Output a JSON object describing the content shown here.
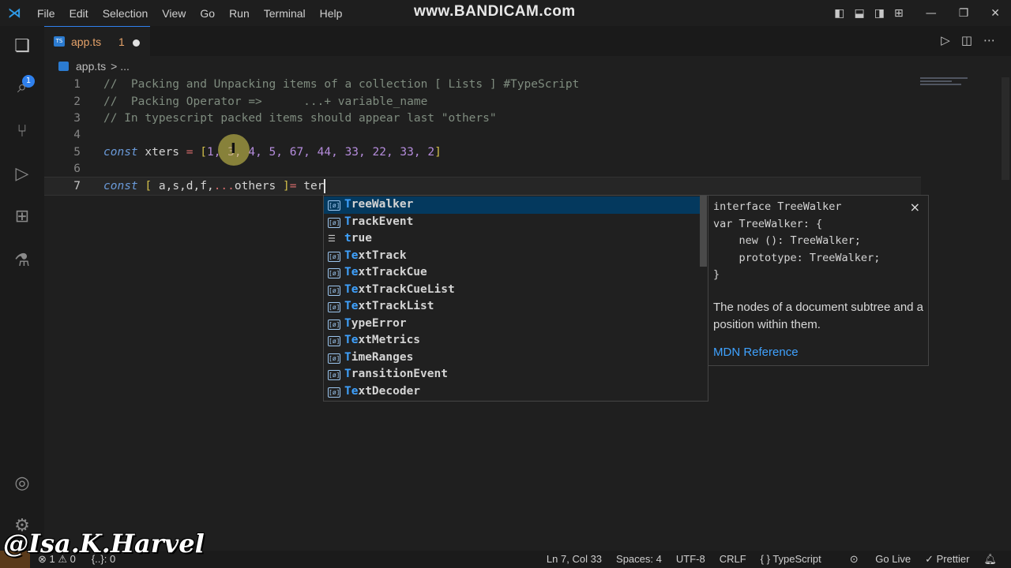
{
  "titlebar": {
    "menu": [
      "File",
      "Edit",
      "Selection",
      "View",
      "Go",
      "Run",
      "Terminal",
      "Help"
    ],
    "watermark": "www.BANDICAM.com"
  },
  "activity": {
    "badge": "1"
  },
  "tab": {
    "name": "app.ts",
    "count": "1",
    "ts_icon": "TS"
  },
  "breadcrumb": {
    "file": "app.ts",
    "rest": "> ..."
  },
  "editor": {
    "line_numbers": [
      "1",
      "2",
      "3",
      "4",
      "5",
      "6",
      "7"
    ],
    "line1": "//  Packing and Unpacking items of a collection [ Lists ] #TypeScript",
    "line2": "//  Packing Operator =>      ...+ variable_name",
    "line3": "// In typescript packed items should appear last \"others\"",
    "line5": {
      "kw": "const",
      "name": " xters ",
      "eq": "=",
      "open": " [",
      "nums": "1, 3, 4, 5, 67, 44, 33, 22, 33, 2",
      "close": "]"
    },
    "line7": {
      "kw": "const",
      "open": " [ ",
      "vars": "a,s,d,f,",
      "spread": "...",
      "rest": "others ",
      "close": "]",
      "eq": "=",
      "typed": " ter"
    }
  },
  "suggest": {
    "items": [
      {
        "match": "T",
        "text": "reeWalker",
        "kind": "ref"
      },
      {
        "match": "T",
        "text": "rackEvent",
        "kind": "ref"
      },
      {
        "match": "t",
        "text": "rue",
        "kind": "kw"
      },
      {
        "match": "Te",
        "text": "xtTrack",
        "kind": "ref"
      },
      {
        "match": "Te",
        "text": "xtTrackCue",
        "kind": "ref"
      },
      {
        "match": "Te",
        "text": "xtTrackCueList",
        "kind": "ref"
      },
      {
        "match": "Te",
        "text": "xtTrackList",
        "kind": "ref"
      },
      {
        "match": "T",
        "text": "ypeError",
        "kind": "ref"
      },
      {
        "match": "Te",
        "text": "xtMetrics",
        "kind": "ref"
      },
      {
        "match": "T",
        "text": "imeRanges",
        "kind": "ref"
      },
      {
        "match": "T",
        "text": "ransitionEvent",
        "kind": "ref"
      },
      {
        "match": "Te",
        "text": "xtDecoder",
        "kind": "ref"
      }
    ],
    "ref_icon": "[ø]"
  },
  "doc": {
    "signature": "interface TreeWalker\nvar TreeWalker: {\n    new (): TreeWalker;\n    prototype: TreeWalker;\n}",
    "description": "The nodes of a document subtree and a position within them.",
    "link": "MDN Reference",
    "close": "×"
  },
  "status": {
    "problems": "⊗ 1 ⚠ 0",
    "braces": "{..}: 0",
    "position": "Ln 7, Col 33",
    "spaces": "Spaces: 4",
    "encoding": "UTF-8",
    "eol": "CRLF",
    "language": "{ }  TypeScript",
    "golive": "Go Live",
    "prettier": "✓ Prettier"
  },
  "overlay": {
    "handle": "@Isa.K.Harvel"
  },
  "colors": {
    "accent": "#2f80ed",
    "selection": "#04395e",
    "link": "#3fa2ff"
  }
}
